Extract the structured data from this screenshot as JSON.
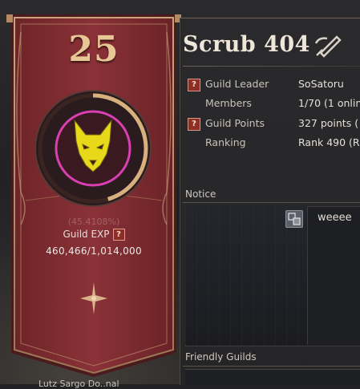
{
  "banner": {
    "level": "25",
    "exp_percent": "(45.4108%)",
    "exp_label": "Guild EXP",
    "exp_value": "460,466/1,014,000",
    "exp_fraction": 0.454108,
    "emblem_icon": "wolf-emblem-icon",
    "bottom_text": "Lutz Sargo Do..nal"
  },
  "guild": {
    "name": "Scrub 404",
    "edit_icon": "edit-pencil-icon"
  },
  "info": {
    "rows": [
      {
        "label": "Guild Leader",
        "value": "SoSatoru",
        "help": "?"
      },
      {
        "label": "Members",
        "value": "1/70 (1 onlin",
        "help": ""
      },
      {
        "label": "Guild Points",
        "value": "327 points (",
        "help": "?"
      },
      {
        "label": "Ranking",
        "value": "Rank 490 (R",
        "help": ""
      }
    ]
  },
  "notice": {
    "title": "Notice",
    "text": "weeee",
    "translate_icon": "translate-icon"
  },
  "friendly": {
    "title": "Friendly Guilds"
  },
  "colors": {
    "banner_red": "#7a2a2e",
    "gold": "#e8c796",
    "emblem_yellow": "#e8d81a",
    "emblem_ring": "#d83fb0"
  }
}
